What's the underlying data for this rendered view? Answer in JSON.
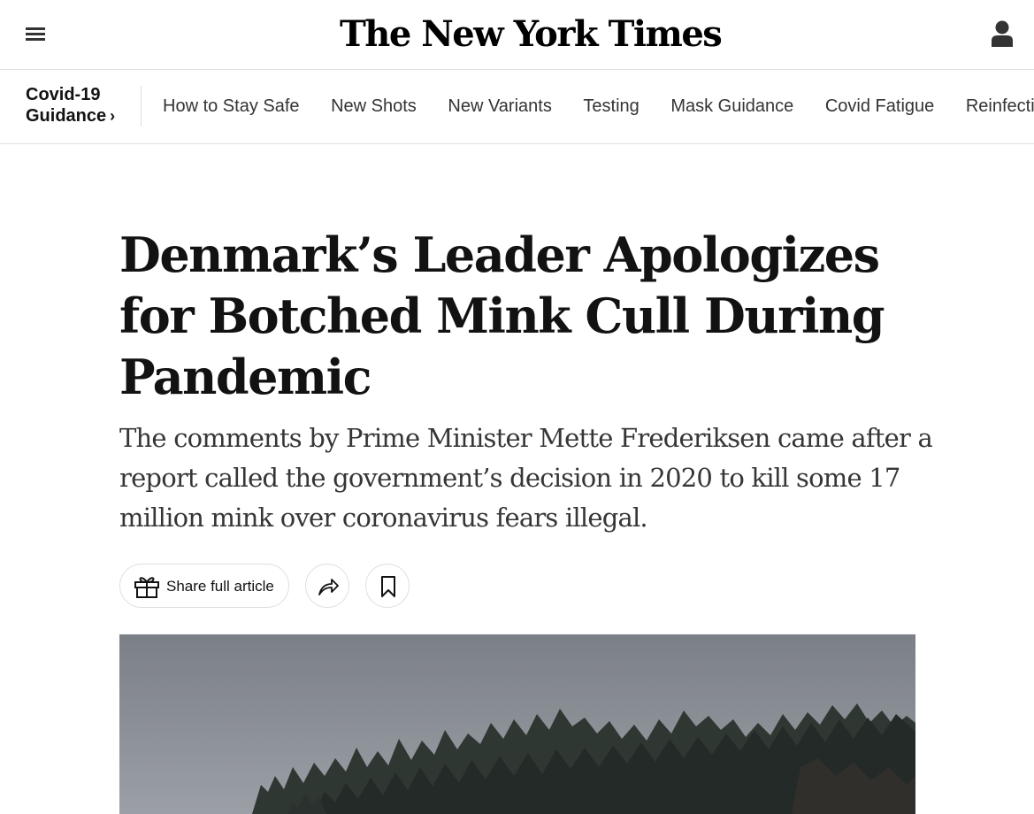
{
  "masthead": {
    "logo_text": "The New York Times",
    "menu_icon": "hamburger-menu-icon",
    "account_icon": "user-account-icon"
  },
  "subnav": {
    "guide_title_line1": "Covid-19",
    "guide_title_line2": "Guidance",
    "guide_chevron": "›",
    "links": [
      "How to Stay Safe",
      "New Shots",
      "New Variants",
      "Testing",
      "Mask Guidance",
      "Covid Fatigue",
      "Reinfections"
    ]
  },
  "article": {
    "headline": "Denmark’s Leader Apologizes for Botched Mink Cull During Pandemic",
    "summary": "The comments by Prime Minister Mette Frederiksen came after a report called the government’s decision in 2020 to kill some 17 million mink over coronavirus fears illegal.",
    "share_full_label": "Share full article",
    "share_icon": "share-arrow-icon",
    "save_icon": "bookmark-icon",
    "gift_icon": "gift-icon"
  },
  "colors": {
    "text": "#121212",
    "border": "#dfdfdf",
    "sky": "#8a8e95",
    "trees": "#2c3430"
  }
}
